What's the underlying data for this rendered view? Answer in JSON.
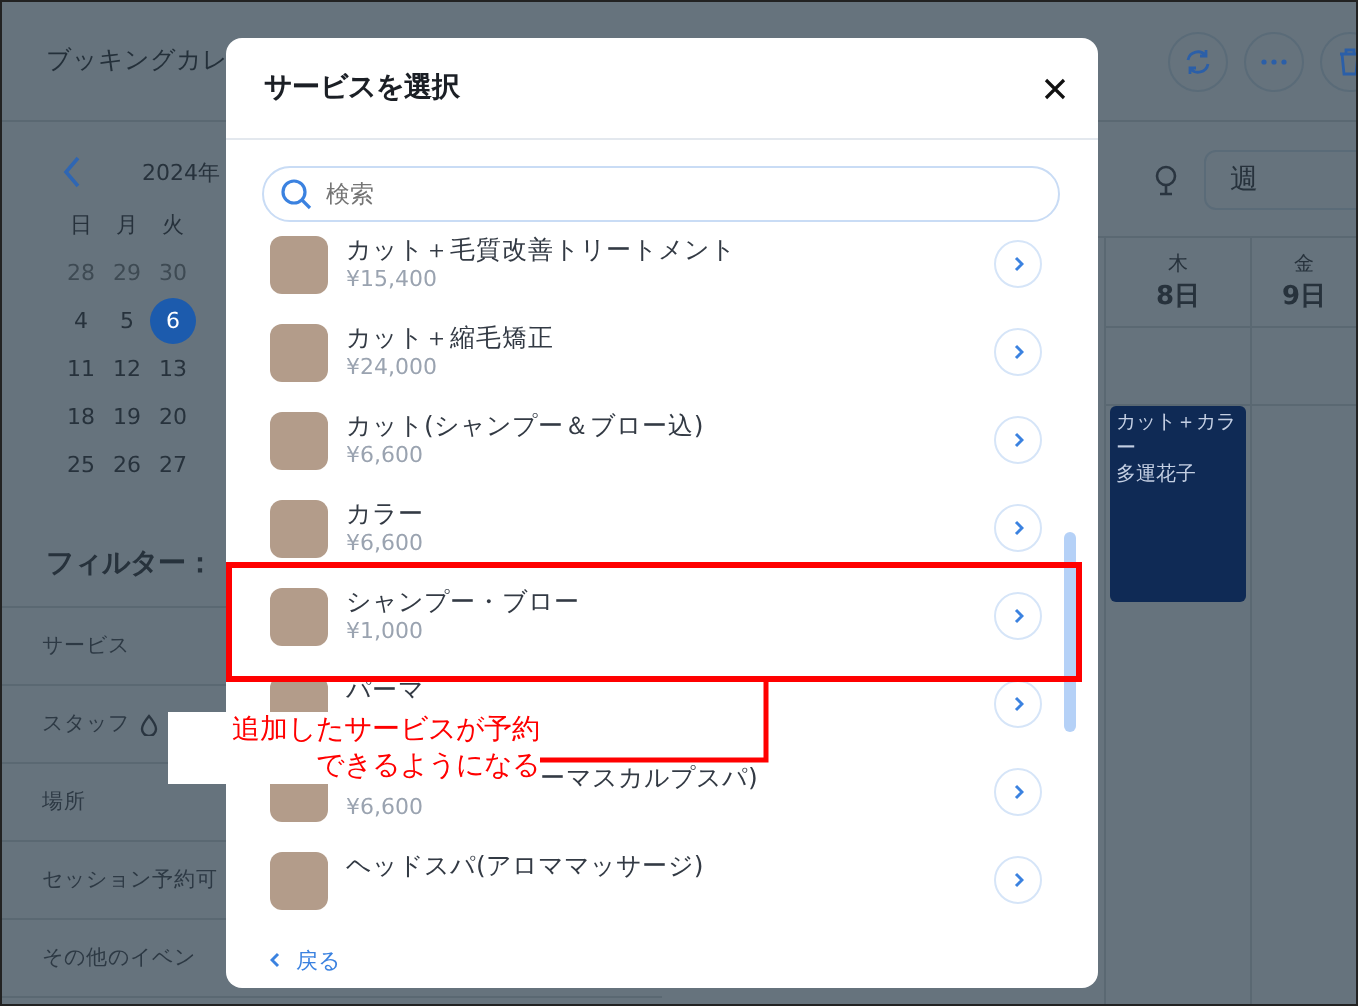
{
  "app": {
    "title": "ブッキングカレ",
    "month": "2024年",
    "weekdays": [
      "日",
      "月",
      "火"
    ],
    "weeks": [
      [
        {
          "day": "28",
          "muted": true,
          "selected": false
        },
        {
          "day": "29",
          "muted": true,
          "selected": false
        },
        {
          "day": "30",
          "muted": true,
          "selected": false
        }
      ],
      [
        {
          "day": "4",
          "muted": false,
          "selected": false
        },
        {
          "day": "5",
          "muted": false,
          "selected": false
        },
        {
          "day": "6",
          "muted": false,
          "selected": true
        }
      ],
      [
        {
          "day": "11",
          "muted": false,
          "selected": false
        },
        {
          "day": "12",
          "muted": false,
          "selected": false
        },
        {
          "day": "13",
          "muted": false,
          "selected": false
        }
      ],
      [
        {
          "day": "18",
          "muted": false,
          "selected": false
        },
        {
          "day": "19",
          "muted": false,
          "selected": false
        },
        {
          "day": "20",
          "muted": false,
          "selected": false
        }
      ],
      [
        {
          "day": "25",
          "muted": false,
          "selected": false
        },
        {
          "day": "26",
          "muted": false,
          "selected": false
        },
        {
          "day": "27",
          "muted": false,
          "selected": false
        }
      ]
    ],
    "filter_title": "フィルター：",
    "filters": [
      {
        "label": "サービス",
        "info": false
      },
      {
        "label": "スタッフ",
        "info": true
      },
      {
        "label": "場所",
        "info": false
      },
      {
        "label": "セッション予約可",
        "info": false
      },
      {
        "label": "その他のイベン",
        "info": false
      }
    ],
    "view": "週",
    "days": [
      {
        "weekday": "木",
        "date": "8日"
      },
      {
        "weekday": "金",
        "date": "9日"
      }
    ],
    "event": {
      "title": "カット＋カラー",
      "staff": "多運花子"
    }
  },
  "dialog": {
    "title": "サービスを選択",
    "search": {
      "placeholder": "検索"
    },
    "services": [
      {
        "name": "カット＋毛質改善トリートメント",
        "price": "¥15,400"
      },
      {
        "name": "カット＋縮毛矯正",
        "price": "¥24,000"
      },
      {
        "name": "カット(シャンプー＆ブロー込)",
        "price": "¥6,600"
      },
      {
        "name": "カラー",
        "price": "¥6,600"
      },
      {
        "name": "シャンプー・ブロー",
        "price": "¥1,000"
      },
      {
        "name": "パーマ"
      },
      {
        "name": "ーマスカルプスパ)",
        "price": "¥6,600",
        "covered": true
      },
      {
        "name": "ヘッドスパ(アロママッサージ)"
      }
    ],
    "back": "戻る"
  },
  "annotation": {
    "lines": [
      "追加したサービスが予約",
      "できるようになる"
    ]
  }
}
